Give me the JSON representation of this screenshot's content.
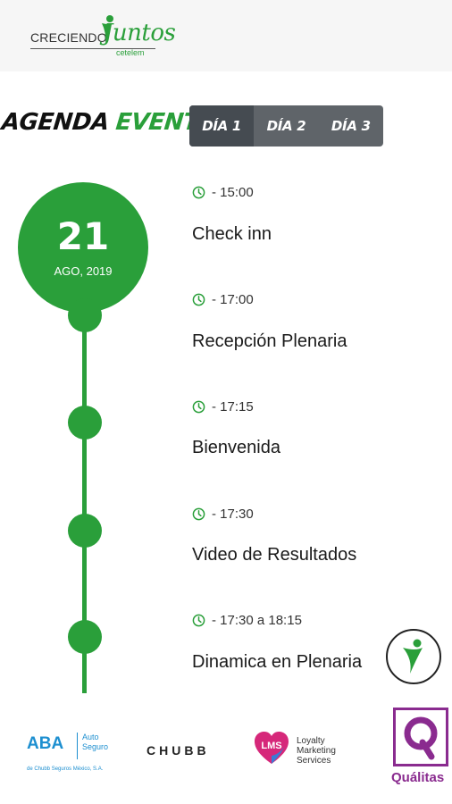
{
  "header": {
    "brand_left": "CRECIENDO",
    "brand_script": "Juntos",
    "brand_sub": "cetelem"
  },
  "title": {
    "word1": "AGENDA",
    "word2": "EVENTO"
  },
  "tabs": [
    {
      "label": "DÍA 1",
      "active": true
    },
    {
      "label": "DÍA 2",
      "active": false
    },
    {
      "label": "DÍA 3",
      "active": false
    }
  ],
  "date": {
    "day": "21",
    "month_year": "AGO, 2019"
  },
  "schedule": [
    {
      "time": "- 15:00",
      "title": "Check inn"
    },
    {
      "time": "- 17:00",
      "title": "Recepción Plenaria"
    },
    {
      "time": "- 17:15",
      "title": "Bienvenida"
    },
    {
      "time": "- 17:30",
      "title": "Video de Resultados"
    },
    {
      "time": "- 17:30 a 18:15",
      "title": "Dinamica en Plenaria"
    }
  ],
  "sponsors": {
    "aba": {
      "main": "ABA",
      "side_1": "Auto",
      "side_2": "Seguro",
      "foot": "de Chubb Seguros México, S.A."
    },
    "chubb": "CHUBB",
    "lms": {
      "mark": "LMS",
      "line_1": "Loyalty",
      "line_2": "Marketing",
      "line_3": "Services"
    },
    "qualitas": "Quálitas"
  },
  "colors": {
    "green": "#2a9f3a",
    "tab_bg": "#5f6469",
    "tab_active": "#454b51"
  },
  "icons": {
    "time": "clock-icon",
    "brand": "person-figure-icon"
  }
}
